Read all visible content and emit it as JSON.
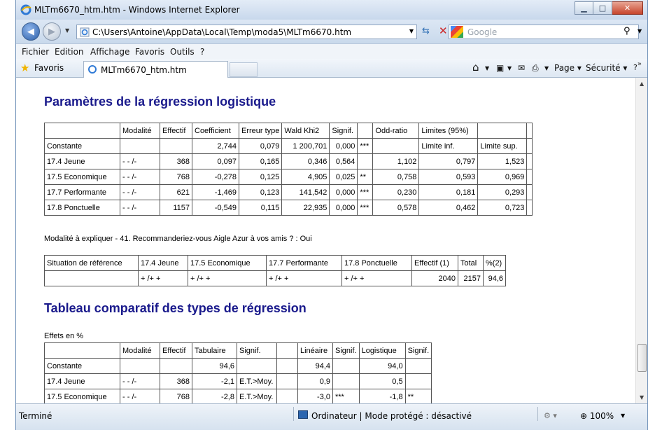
{
  "window": {
    "title": "MLTm6670_htm.htm - Windows Internet Explorer",
    "minimize": "▁",
    "maximize": "□",
    "close": "✕"
  },
  "address": {
    "url": "C:\\Users\\Antoine\\AppData\\Local\\Temp\\moda5\\MLTm6670.htm",
    "search_placeholder": "Google"
  },
  "menu": [
    "Fichier",
    "Edition",
    "Affichage",
    "Favoris",
    "Outils",
    "?"
  ],
  "favorites": {
    "label": "Favoris",
    "tab_title": "MLTm6670_htm.htm",
    "commands": [
      "Page ▾",
      "Sécurité ▾",
      "Outils ▾"
    ]
  },
  "content": {
    "title1": "Paramètres de la régression logistique",
    "table1": {
      "header": [
        "",
        "Modalité",
        "Effectif",
        "Coefficient",
        "Erreur type",
        "Wald Khi2",
        "Signif.",
        "",
        "Odd-ratio",
        "Limites (95%)",
        "",
        ""
      ],
      "rows": [
        [
          "Constante",
          "",
          "",
          "2,744",
          "0,079",
          "1 200,701",
          "0,000",
          "***",
          "",
          "Limite inf.",
          "Limite sup."
        ],
        [
          "17.4 Jeune",
          "- - /-",
          "368",
          "0,097",
          "0,165",
          "0,346",
          "0,564",
          "",
          "1,102",
          "0,797",
          "1,523"
        ],
        [
          "17.5 Economique",
          "- - /-",
          "768",
          "-0,278",
          "0,125",
          "4,905",
          "0,025",
          "**",
          "0,758",
          "0,593",
          "0,969"
        ],
        [
          "17.7 Performante",
          "- - /-",
          "621",
          "-1,469",
          "0,123",
          "141,542",
          "0,000",
          "***",
          "0,230",
          "0,181",
          "0,293"
        ],
        [
          "17.8 Ponctuelle",
          "- - /-",
          "1157",
          "-0,549",
          "0,115",
          "22,935",
          "0,000",
          "***",
          "0,578",
          "0,462",
          "0,723"
        ]
      ]
    },
    "note": "Modalité à expliquer - 41. Recommanderiez-vous Aigle Azur à vos amis ? : Oui",
    "table2": {
      "header": [
        "Situation de référence",
        "17.4 Jeune",
        "17.5 Economique",
        "17.7 Performante",
        "17.8 Ponctuelle",
        "Effectif (1)",
        "Total",
        "%(2)"
      ],
      "row": [
        "",
        "+ /+ +",
        "+ /+ +",
        "+ /+ +",
        "+ /+ +",
        "2040",
        "2157",
        "94,6"
      ]
    },
    "title2": "Tableau comparatif des types de régression",
    "effets": "Effets en %",
    "table3": {
      "header": [
        "",
        "Modalité",
        "Effectif",
        "Tabulaire",
        "Signif.",
        "",
        "Linéaire",
        "Signif.",
        "Logistique",
        "Signif."
      ],
      "rows": [
        [
          "Constante",
          "",
          "",
          "94,6",
          "",
          "",
          "94,4",
          "",
          "94,0",
          ""
        ],
        [
          "17.4 Jeune",
          "- - /-",
          "368",
          "-2,1",
          "E.T.>Moy.",
          "",
          "0,9",
          "",
          "0,5",
          ""
        ],
        [
          "17.5 Economique",
          "- - /-",
          "768",
          "-2,8",
          "E.T.>Moy.",
          "",
          "-3,0",
          "***",
          "-1,8",
          "**"
        ]
      ]
    }
  },
  "status": {
    "left": "Terminé",
    "zone": "Ordinateur | Mode protégé : désactivé",
    "zoom": "100%"
  }
}
